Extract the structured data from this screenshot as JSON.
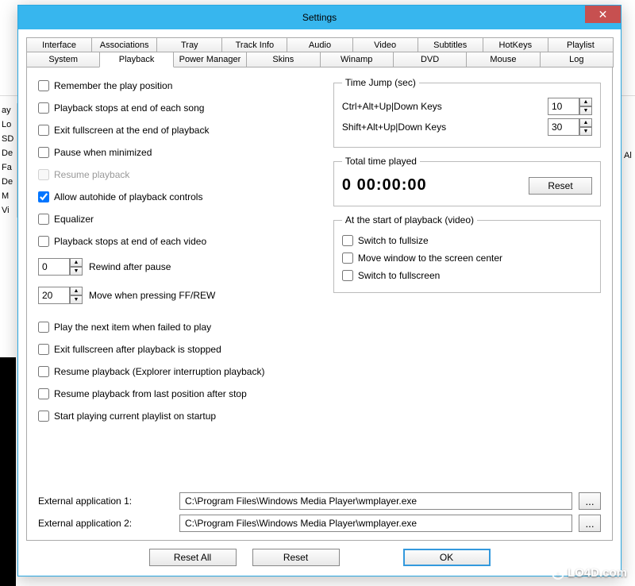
{
  "window": {
    "title": "Settings"
  },
  "tabs_row1": [
    "Interface",
    "Associations",
    "Tray",
    "Track Info",
    "Audio",
    "Video",
    "Subtitles",
    "HotKeys",
    "Playlist"
  ],
  "tabs_row2": [
    "System",
    "Playback",
    "Power Manager",
    "Skins",
    "Winamp",
    "DVD",
    "Mouse",
    "Log"
  ],
  "active_tab": "Playback",
  "playback_options": {
    "remember_position": {
      "label": "Remember the play position",
      "checked": false
    },
    "stop_end_song": {
      "label": "Playback stops at end of each song",
      "checked": false
    },
    "exit_fs_end": {
      "label": "Exit fullscreen at the end of playback",
      "checked": false
    },
    "pause_minimized": {
      "label": "Pause when minimized",
      "checked": false
    },
    "resume_playback": {
      "label": "Resume playback",
      "checked": false,
      "disabled": true
    },
    "allow_autohide": {
      "label": "Allow autohide of playback controls",
      "checked": true
    },
    "equalizer": {
      "label": "Equalizer",
      "checked": false
    },
    "stop_end_video": {
      "label": "Playback stops at end of each video",
      "checked": false
    },
    "rewind_after_pause": {
      "value": "0",
      "label": "Rewind after pause"
    },
    "move_ff_rew": {
      "value": "20",
      "label": "Move when pressing FF/REW"
    },
    "play_next_failed": {
      "label": "Play the next item when failed to play",
      "checked": false
    },
    "exit_fs_stopped": {
      "label": "Exit fullscreen after playback is stopped",
      "checked": false
    },
    "resume_explorer": {
      "label": "Resume playback  (Explorer interruption playback)",
      "checked": false
    },
    "resume_last_pos": {
      "label": "Resume playback from last position after stop",
      "checked": false
    },
    "start_playlist": {
      "label": "Start playing current playlist on startup",
      "checked": false
    }
  },
  "time_jump": {
    "legend": "Time Jump (sec)",
    "ctrl_label": "Ctrl+Alt+Up|Down Keys",
    "ctrl_value": "10",
    "shift_label": "Shift+Alt+Up|Down Keys",
    "shift_value": "30"
  },
  "total_time": {
    "legend": "Total time played",
    "value": "0 00:00:00",
    "reset": "Reset"
  },
  "start_playback": {
    "legend": "At the start of playback (video)",
    "fullsize": {
      "label": "Switch to fullsize",
      "checked": false
    },
    "center": {
      "label": "Move window to the screen center",
      "checked": false
    },
    "fullscreen": {
      "label": "Switch to fullscreen",
      "checked": false
    }
  },
  "external": {
    "label1": "External application 1:",
    "path1": "C:\\Program Files\\Windows Media Player\\wmplayer.exe",
    "label2": "External application 2:",
    "path2": "C:\\Program Files\\Windows Media Player\\wmplayer.exe",
    "browse": "..."
  },
  "buttons": {
    "reset_all": "Reset All",
    "reset": "Reset",
    "ok": "OK"
  },
  "bg_left": [
    "ay",
    "Lo",
    "SD",
    "De",
    "Fa",
    "De",
    "M",
    "Vi"
  ],
  "bg_right": "Al",
  "watermark": "LO4D.com"
}
